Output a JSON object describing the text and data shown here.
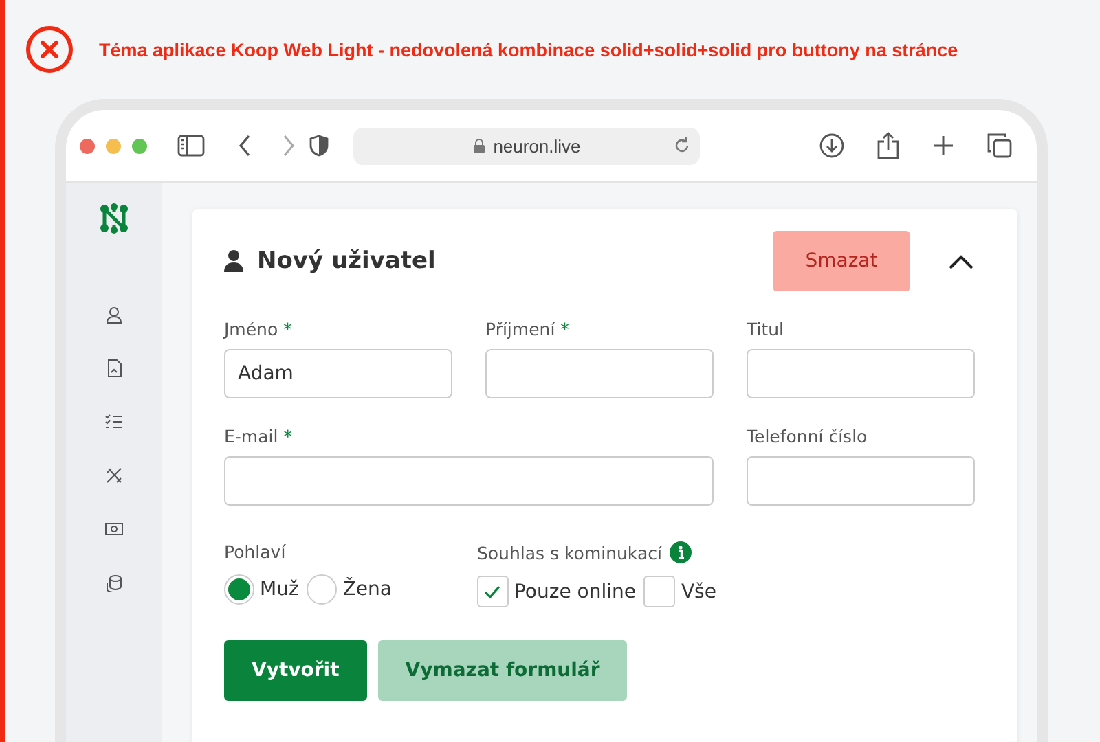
{
  "alert": {
    "message": "Téma aplikace Koop Web Light - nedovolená kombinace solid+solid+solid pro buttony na stránce"
  },
  "browser": {
    "url": "neuron.live"
  },
  "form": {
    "title": "Nový uživatel",
    "delete_button": "Smazat",
    "expanded": true,
    "rows": [
      [
        {
          "label": "Jméno",
          "required_mark": "*",
          "value": "Adam"
        },
        {
          "label": "Příjmení",
          "required_mark": "*"
        },
        {
          "label": "Titul"
        }
      ],
      [
        {
          "label": "E-mail",
          "required_mark": "*"
        },
        null,
        {
          "label": "Telefonní číslo"
        }
      ]
    ],
    "gender": {
      "label": "Pohlaví",
      "options": [
        {
          "label": "Muž",
          "selected": true
        },
        {
          "label": "Žena",
          "selected": false
        }
      ]
    },
    "consent": {
      "label": "Souhlas s kominukací",
      "options": [
        {
          "label": "Pouze online",
          "checked": true
        },
        {
          "label": "Vše",
          "checked": false
        }
      ]
    },
    "buttons": [
      {
        "label": "Vytvořit",
        "kind": "primary"
      },
      {
        "label": "Vymazat formulář",
        "kind": "secondary"
      }
    ]
  }
}
